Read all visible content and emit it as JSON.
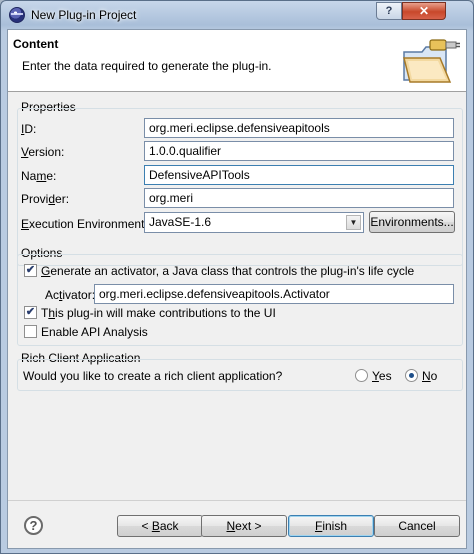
{
  "window": {
    "title": "New Plug-in Project",
    "help_glyph": "?",
    "close_glyph": "✕"
  },
  "header": {
    "title": "Content",
    "description": "Enter the data required to generate the plug-in.",
    "icon": "folder-plugin-icon"
  },
  "properties": {
    "section_label": "Properties",
    "id": {
      "label_mnemonic": "I",
      "label_rest": "D:",
      "value": "org.meri.eclipse.defensiveapitools"
    },
    "version": {
      "label_mnemonic": "V",
      "label_rest": "ersion:",
      "value": "1.0.0.qualifier"
    },
    "name": {
      "label_prefix": "Na",
      "label_mnemonic": "m",
      "label_rest": "e:",
      "value": "DefensiveAPITools"
    },
    "provider": {
      "label_prefix": "Provi",
      "label_mnemonic": "d",
      "label_rest": "er:",
      "value": "org.meri"
    },
    "execution_environment": {
      "label_mnemonic": "E",
      "label_rest": "xecution Environment:",
      "value": "JavaSE-1.6",
      "button_label": "Environments..."
    }
  },
  "options": {
    "section_label": "Options",
    "generate_activator": {
      "checked": true,
      "label_mnemonic": "G",
      "label_rest": "enerate an activator, a Java class that controls the plug-in's life cycle"
    },
    "activator": {
      "label_prefix": "Ac",
      "label_mnemonic": "t",
      "label_rest": "ivator:",
      "value": "org.meri.eclipse.defensiveapitools.Activator"
    },
    "ui_contributions": {
      "checked": true,
      "label_prefix": "T",
      "label_mnemonic": "h",
      "label_rest": "is plug-in will make contributions to the UI"
    },
    "api_analysis": {
      "checked": false,
      "label": "Enable API Analysis"
    }
  },
  "rich_client": {
    "section_label": "Rich Client Application",
    "question": "Would you like to create a rich client application?",
    "yes": {
      "label_mnemonic": "Y",
      "label_rest": "es",
      "selected": false
    },
    "no": {
      "label_mnemonic": "N",
      "label_rest": "o",
      "selected": true
    }
  },
  "footer": {
    "help_glyph": "?",
    "back": {
      "label_prefix": "< ",
      "label_mnemonic": "B",
      "label_rest": "ack"
    },
    "next": {
      "label_mnemonic": "N",
      "label_rest": "ext >"
    },
    "finish": {
      "label_mnemonic": "F",
      "label_rest": "inish"
    },
    "cancel": {
      "label": "Cancel"
    }
  },
  "checkmark": "✔"
}
